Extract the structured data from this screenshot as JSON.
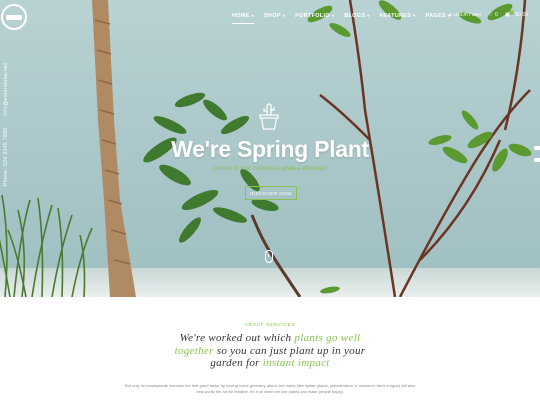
{
  "header": {
    "nav": [
      {
        "label": "HOME",
        "active": true
      },
      {
        "label": "SHOP",
        "active": false
      },
      {
        "label": "PORTFOLIO",
        "active": false
      },
      {
        "label": "BLOGS",
        "active": false
      },
      {
        "label": "FEATURES",
        "active": false
      },
      {
        "label": "PAGES",
        "active": false
      }
    ],
    "account_label": "usd.m / user",
    "wishlist_count": "0",
    "cart_total": "$0.00",
    "icons": [
      "logo",
      "user-icon",
      "heart-icon",
      "cart-icon"
    ]
  },
  "side_contact": {
    "phone": "Phone: 024 2345 7890",
    "email": "info@enterstone.net"
  },
  "hero": {
    "title": "We're Spring Plant",
    "subtitle": "Lorem in hac habitasse platea dictumst",
    "button_label": "DISCOVER NOW"
  },
  "about": {
    "eyebrow": "ABOUT SERVICES",
    "heading_line1_a": "We're worked out which ",
    "heading_line1_hl": "plants go well",
    "heading_line2_hl": "together",
    "heading_line2_b": " so you can just plant up in your",
    "heading_line3_a": "garden ",
    "heading_line3_b": "for ",
    "heading_line3_hl": "instant impact",
    "body_line1": "Not only do houseplants increase the feel-good factor by having some greenery about, but many (like spider plants, philodendron or mother in law's tongue) will also",
    "body_line2": "help purify the air we breathe. It's true when we see plants can make people happy."
  },
  "colors": {
    "accent": "#8cc152",
    "text": "#333333",
    "hero_bg": "#a9c6c8"
  }
}
